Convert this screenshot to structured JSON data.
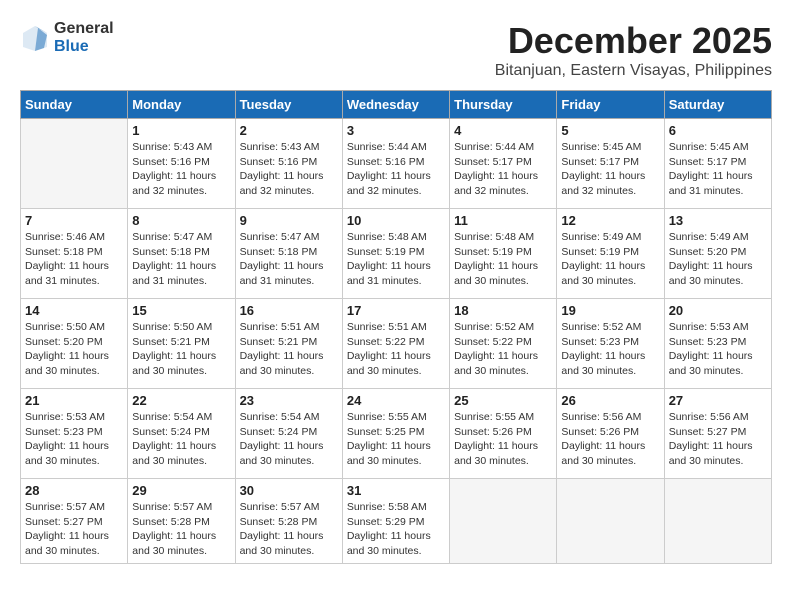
{
  "logo": {
    "general": "General",
    "blue": "Blue"
  },
  "title": "December 2025",
  "subtitle": "Bitanjuan, Eastern Visayas, Philippines",
  "weekdays": [
    "Sunday",
    "Monday",
    "Tuesday",
    "Wednesday",
    "Thursday",
    "Friday",
    "Saturday"
  ],
  "weeks": [
    [
      {
        "day": "",
        "info": ""
      },
      {
        "day": "1",
        "info": "Sunrise: 5:43 AM\nSunset: 5:16 PM\nDaylight: 11 hours\nand 32 minutes."
      },
      {
        "day": "2",
        "info": "Sunrise: 5:43 AM\nSunset: 5:16 PM\nDaylight: 11 hours\nand 32 minutes."
      },
      {
        "day": "3",
        "info": "Sunrise: 5:44 AM\nSunset: 5:16 PM\nDaylight: 11 hours\nand 32 minutes."
      },
      {
        "day": "4",
        "info": "Sunrise: 5:44 AM\nSunset: 5:17 PM\nDaylight: 11 hours\nand 32 minutes."
      },
      {
        "day": "5",
        "info": "Sunrise: 5:45 AM\nSunset: 5:17 PM\nDaylight: 11 hours\nand 32 minutes."
      },
      {
        "day": "6",
        "info": "Sunrise: 5:45 AM\nSunset: 5:17 PM\nDaylight: 11 hours\nand 31 minutes."
      }
    ],
    [
      {
        "day": "7",
        "info": "Sunrise: 5:46 AM\nSunset: 5:18 PM\nDaylight: 11 hours\nand 31 minutes."
      },
      {
        "day": "8",
        "info": "Sunrise: 5:47 AM\nSunset: 5:18 PM\nDaylight: 11 hours\nand 31 minutes."
      },
      {
        "day": "9",
        "info": "Sunrise: 5:47 AM\nSunset: 5:18 PM\nDaylight: 11 hours\nand 31 minutes."
      },
      {
        "day": "10",
        "info": "Sunrise: 5:48 AM\nSunset: 5:19 PM\nDaylight: 11 hours\nand 31 minutes."
      },
      {
        "day": "11",
        "info": "Sunrise: 5:48 AM\nSunset: 5:19 PM\nDaylight: 11 hours\nand 30 minutes."
      },
      {
        "day": "12",
        "info": "Sunrise: 5:49 AM\nSunset: 5:19 PM\nDaylight: 11 hours\nand 30 minutes."
      },
      {
        "day": "13",
        "info": "Sunrise: 5:49 AM\nSunset: 5:20 PM\nDaylight: 11 hours\nand 30 minutes."
      }
    ],
    [
      {
        "day": "14",
        "info": "Sunrise: 5:50 AM\nSunset: 5:20 PM\nDaylight: 11 hours\nand 30 minutes."
      },
      {
        "day": "15",
        "info": "Sunrise: 5:50 AM\nSunset: 5:21 PM\nDaylight: 11 hours\nand 30 minutes."
      },
      {
        "day": "16",
        "info": "Sunrise: 5:51 AM\nSunset: 5:21 PM\nDaylight: 11 hours\nand 30 minutes."
      },
      {
        "day": "17",
        "info": "Sunrise: 5:51 AM\nSunset: 5:22 PM\nDaylight: 11 hours\nand 30 minutes."
      },
      {
        "day": "18",
        "info": "Sunrise: 5:52 AM\nSunset: 5:22 PM\nDaylight: 11 hours\nand 30 minutes."
      },
      {
        "day": "19",
        "info": "Sunrise: 5:52 AM\nSunset: 5:23 PM\nDaylight: 11 hours\nand 30 minutes."
      },
      {
        "day": "20",
        "info": "Sunrise: 5:53 AM\nSunset: 5:23 PM\nDaylight: 11 hours\nand 30 minutes."
      }
    ],
    [
      {
        "day": "21",
        "info": "Sunrise: 5:53 AM\nSunset: 5:23 PM\nDaylight: 11 hours\nand 30 minutes."
      },
      {
        "day": "22",
        "info": "Sunrise: 5:54 AM\nSunset: 5:24 PM\nDaylight: 11 hours\nand 30 minutes."
      },
      {
        "day": "23",
        "info": "Sunrise: 5:54 AM\nSunset: 5:24 PM\nDaylight: 11 hours\nand 30 minutes."
      },
      {
        "day": "24",
        "info": "Sunrise: 5:55 AM\nSunset: 5:25 PM\nDaylight: 11 hours\nand 30 minutes."
      },
      {
        "day": "25",
        "info": "Sunrise: 5:55 AM\nSunset: 5:26 PM\nDaylight: 11 hours\nand 30 minutes."
      },
      {
        "day": "26",
        "info": "Sunrise: 5:56 AM\nSunset: 5:26 PM\nDaylight: 11 hours\nand 30 minutes."
      },
      {
        "day": "27",
        "info": "Sunrise: 5:56 AM\nSunset: 5:27 PM\nDaylight: 11 hours\nand 30 minutes."
      }
    ],
    [
      {
        "day": "28",
        "info": "Sunrise: 5:57 AM\nSunset: 5:27 PM\nDaylight: 11 hours\nand 30 minutes."
      },
      {
        "day": "29",
        "info": "Sunrise: 5:57 AM\nSunset: 5:28 PM\nDaylight: 11 hours\nand 30 minutes."
      },
      {
        "day": "30",
        "info": "Sunrise: 5:57 AM\nSunset: 5:28 PM\nDaylight: 11 hours\nand 30 minutes."
      },
      {
        "day": "31",
        "info": "Sunrise: 5:58 AM\nSunset: 5:29 PM\nDaylight: 11 hours\nand 30 minutes."
      },
      {
        "day": "",
        "info": ""
      },
      {
        "day": "",
        "info": ""
      },
      {
        "day": "",
        "info": ""
      }
    ]
  ]
}
